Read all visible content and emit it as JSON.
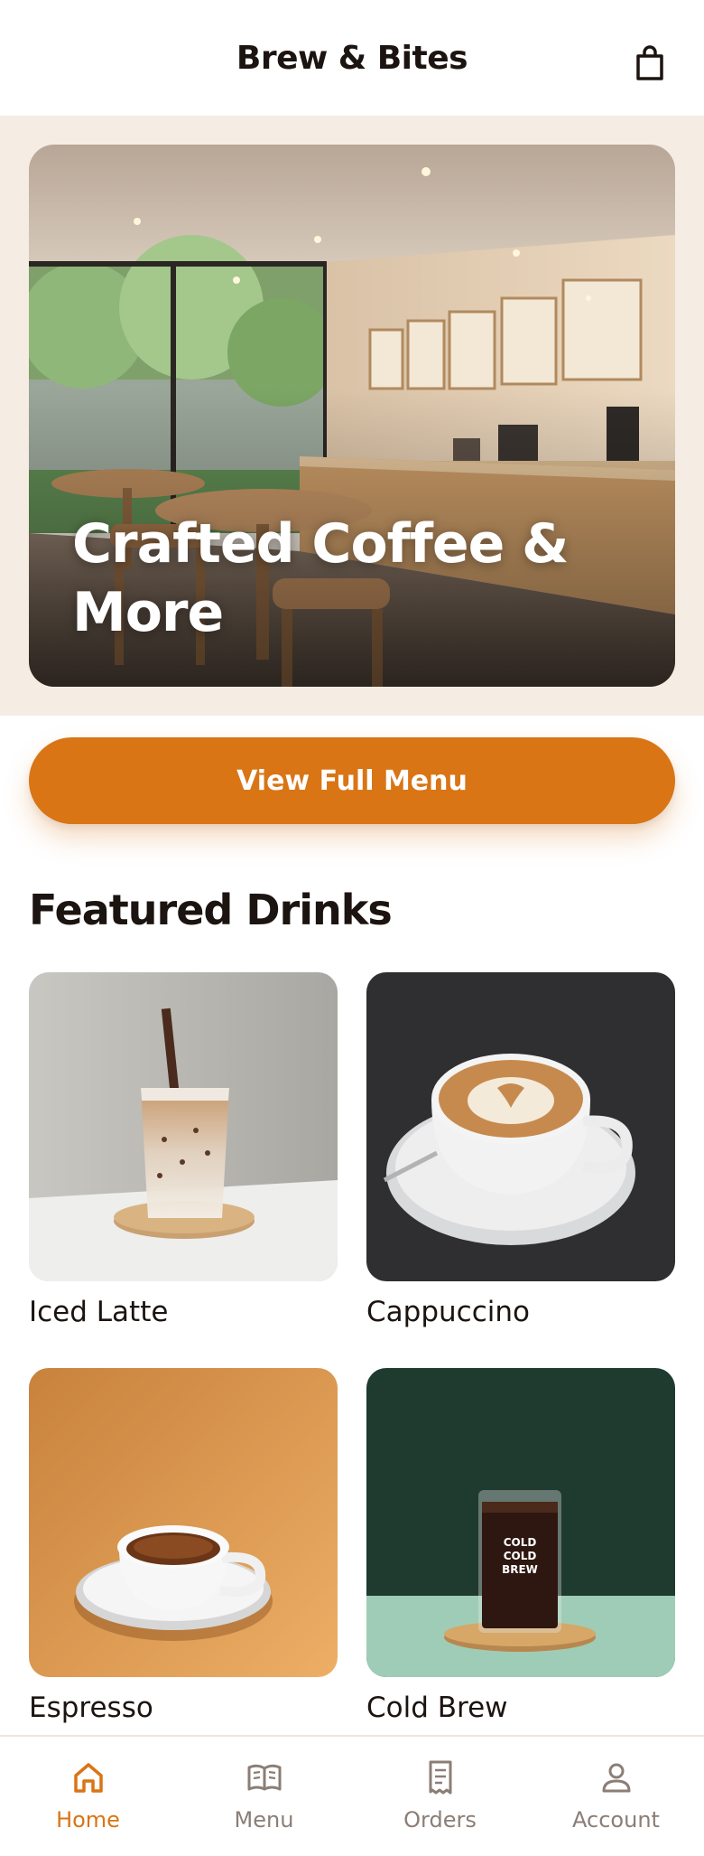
{
  "header": {
    "title": "Brew & Bites",
    "cart_icon": "shopping-bag-icon"
  },
  "hero": {
    "title": "Crafted Coffee & More"
  },
  "cta": {
    "label": "View Full Menu"
  },
  "featured": {
    "title": "Featured Drinks",
    "items": [
      {
        "name": "Iced Latte"
      },
      {
        "name": "Cappuccino"
      },
      {
        "name": "Espresso"
      },
      {
        "name": "Cold Brew"
      }
    ],
    "cold_brew_label": [
      "COLD",
      "COLD",
      "BREW"
    ]
  },
  "tabs": [
    {
      "label": "Home",
      "icon": "home-icon",
      "active": true
    },
    {
      "label": "Menu",
      "icon": "book-icon",
      "active": false
    },
    {
      "label": "Orders",
      "icon": "receipt-icon",
      "active": false
    },
    {
      "label": "Account",
      "icon": "person-icon",
      "active": false
    }
  ],
  "colors": {
    "accent": "#d97515",
    "hero_band": "#f5ece3",
    "text": "#1c1410",
    "muted": "#8b7e76"
  }
}
